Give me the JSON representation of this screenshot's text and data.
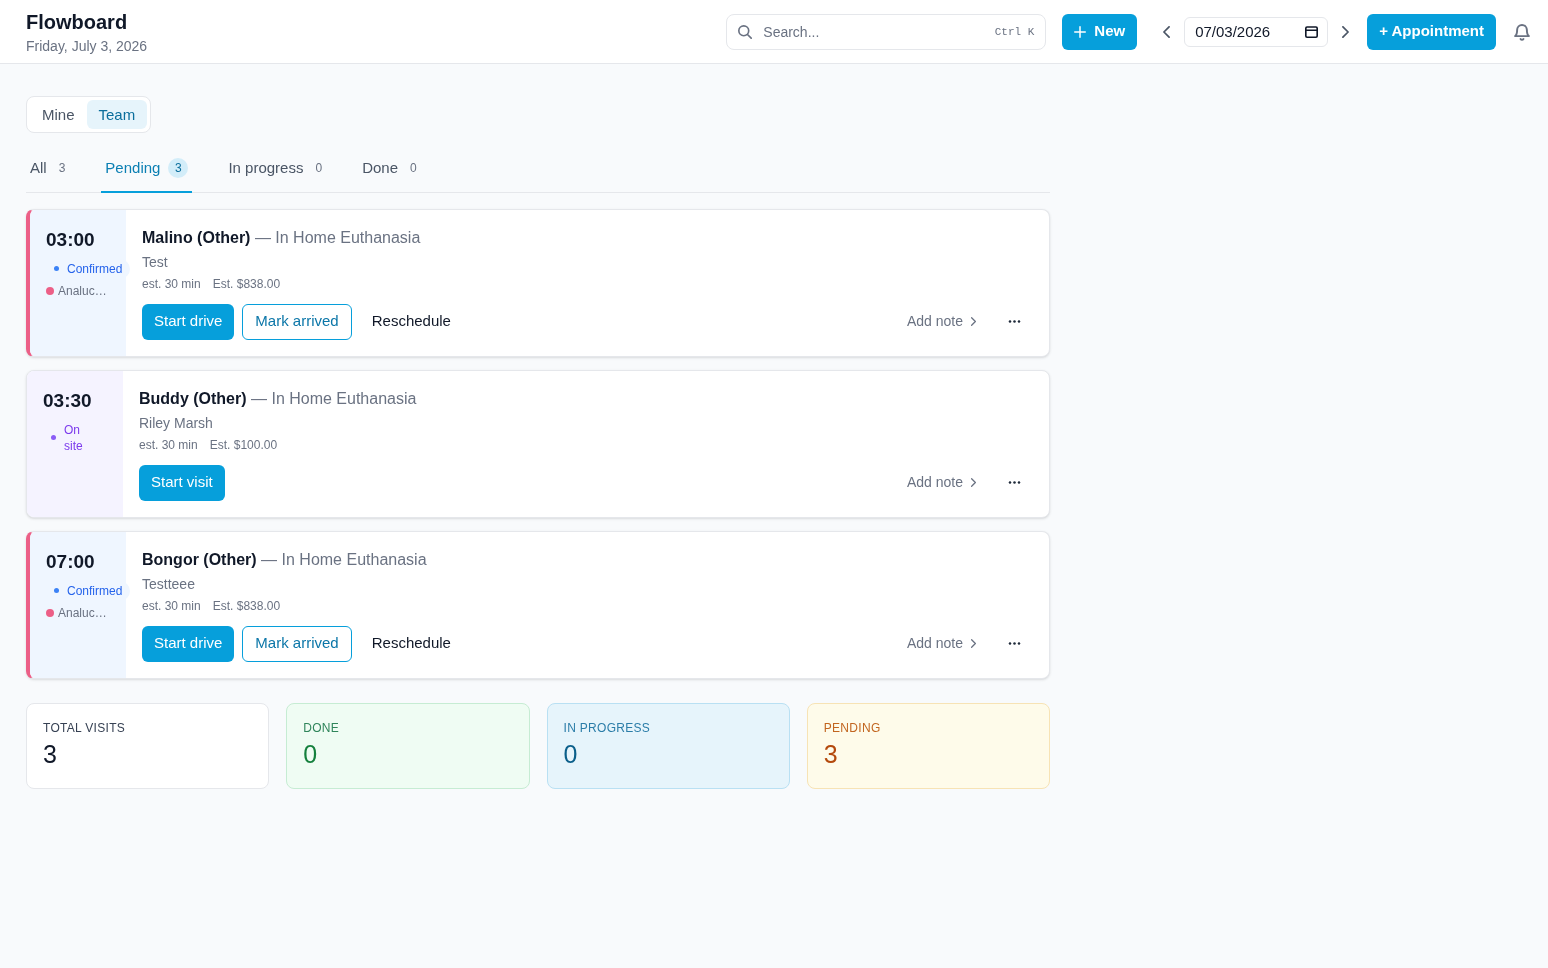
{
  "header": {
    "title": "Flowboard",
    "date": "Friday, July 3, 2026"
  },
  "search": {
    "placeholder": "Search...",
    "shortcut": "Ctrl K"
  },
  "new_button": {
    "label": "New"
  },
  "date_picker": {
    "value": "07/03/2026"
  },
  "appointment_button": {
    "label": "+ Appointment"
  },
  "scope_toggle": [
    {
      "label": "Mine",
      "selected": false
    },
    {
      "label": "Team",
      "selected": true
    }
  ],
  "tabs": [
    {
      "label": "All",
      "count": "3",
      "selected": false
    },
    {
      "label": "Pending",
      "count": "3",
      "selected": true
    },
    {
      "label": "In progress",
      "count": "0",
      "selected": false
    },
    {
      "label": "Done",
      "count": "0",
      "selected": false
    }
  ],
  "visits": [
    {
      "time": "03:00",
      "status": {
        "label": "Confirmed",
        "kind": "confirmed"
      },
      "assignee": {
        "name": "Analuc…",
        "color": "#ec5f87"
      },
      "title": "**Malino (Other)** — In Home Euthanasia",
      "client": "Test",
      "duration": "est. 30 min",
      "estimate": "Est. $838.00",
      "actions": [
        {
          "label": "Start drive",
          "kind": "primary"
        },
        {
          "label": "Mark arrived",
          "kind": "outline"
        },
        {
          "label": "Reschedule",
          "kind": "plain"
        }
      ],
      "note_link": "Add note"
    },
    {
      "time": "03:30",
      "status": {
        "label": "On site",
        "kind": "on_site"
      },
      "title": "**Buddy (Other)** — In Home Euthanasia",
      "client": "Riley Marsh",
      "duration": "est. 30 min",
      "estimate": "Est. $100.00",
      "actions": [
        {
          "label": "Start visit",
          "kind": "primary"
        }
      ],
      "note_link": "Add note"
    },
    {
      "time": "07:00",
      "status": {
        "label": "Confirmed",
        "kind": "confirmed"
      },
      "assignee": {
        "name": "Analuc…",
        "color": "#ec5f87"
      },
      "title": "**Bongor (Other)** — In Home Euthanasia",
      "client": "Testteee",
      "duration": "est. 30 min",
      "estimate": "Est. $838.00",
      "actions": [
        {
          "label": "Start drive",
          "kind": "primary"
        },
        {
          "label": "Mark arrived",
          "kind": "outline"
        },
        {
          "label": "Reschedule",
          "kind": "plain"
        }
      ],
      "note_link": "Add note"
    }
  ],
  "stats": [
    {
      "label": "TOTAL VISITS",
      "value": "3",
      "kind": "total"
    },
    {
      "label": "DONE",
      "value": "0",
      "kind": "done"
    },
    {
      "label": "IN PROGRESS",
      "value": "0",
      "kind": "in_progress"
    },
    {
      "label": "PENDING",
      "value": "3",
      "kind": "pending"
    }
  ]
}
